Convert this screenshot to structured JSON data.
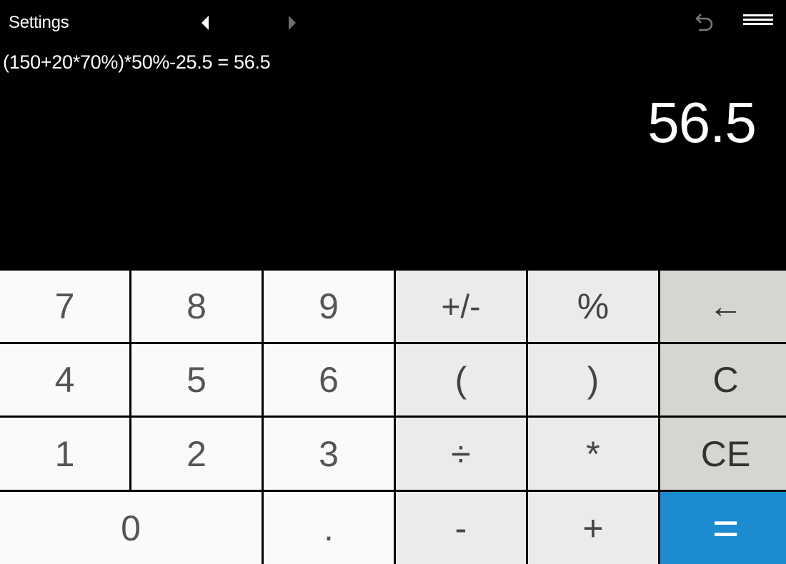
{
  "header": {
    "settings_label": "Settings",
    "back_icon": "triangle-left-icon",
    "forward_icon": "triangle-right-icon",
    "undo_icon": "undo-icon",
    "menu_icon": "hamburger-menu-icon"
  },
  "display": {
    "expression": "(150+20*70%)*50%-25.5 = 56.5",
    "result": "56.5"
  },
  "keys": [
    {
      "label": "7",
      "kind": "num",
      "name": "key-7"
    },
    {
      "label": "8",
      "kind": "num",
      "name": "key-8"
    },
    {
      "label": "9",
      "kind": "num",
      "name": "key-9"
    },
    {
      "label": "+/-",
      "kind": "op",
      "name": "key-negate"
    },
    {
      "label": "%",
      "kind": "op",
      "name": "key-percent"
    },
    {
      "label": "←",
      "kind": "ctl",
      "name": "key-backspace"
    },
    {
      "label": "4",
      "kind": "num",
      "name": "key-4"
    },
    {
      "label": "5",
      "kind": "num",
      "name": "key-5"
    },
    {
      "label": "6",
      "kind": "num",
      "name": "key-6"
    },
    {
      "label": "(",
      "kind": "op",
      "name": "key-open-paren"
    },
    {
      "label": ")",
      "kind": "op",
      "name": "key-close-paren"
    },
    {
      "label": "C",
      "kind": "ctl",
      "name": "key-clear"
    },
    {
      "label": "1",
      "kind": "num",
      "name": "key-1"
    },
    {
      "label": "2",
      "kind": "num",
      "name": "key-2"
    },
    {
      "label": "3",
      "kind": "num",
      "name": "key-3"
    },
    {
      "label": "÷",
      "kind": "op",
      "name": "key-divide"
    },
    {
      "label": "*",
      "kind": "op",
      "name": "key-multiply"
    },
    {
      "label": "CE",
      "kind": "ctl",
      "name": "key-clear-entry"
    },
    {
      "label": "0",
      "kind": "num",
      "name": "key-0"
    },
    {
      "label": ".",
      "kind": "num",
      "name": "key-decimal"
    },
    {
      "label": "-",
      "kind": "op",
      "name": "key-subtract"
    },
    {
      "label": "+",
      "kind": "op",
      "name": "key-add"
    },
    {
      "label": "=",
      "kind": "eq",
      "name": "key-equals"
    }
  ],
  "colors": {
    "display_bg": "#000000",
    "number_key_bg": "#fafafa",
    "operator_key_bg": "#ebebeb",
    "control_key_bg": "#d6d5cf",
    "equals_key_bg": "#1c8bd1"
  }
}
